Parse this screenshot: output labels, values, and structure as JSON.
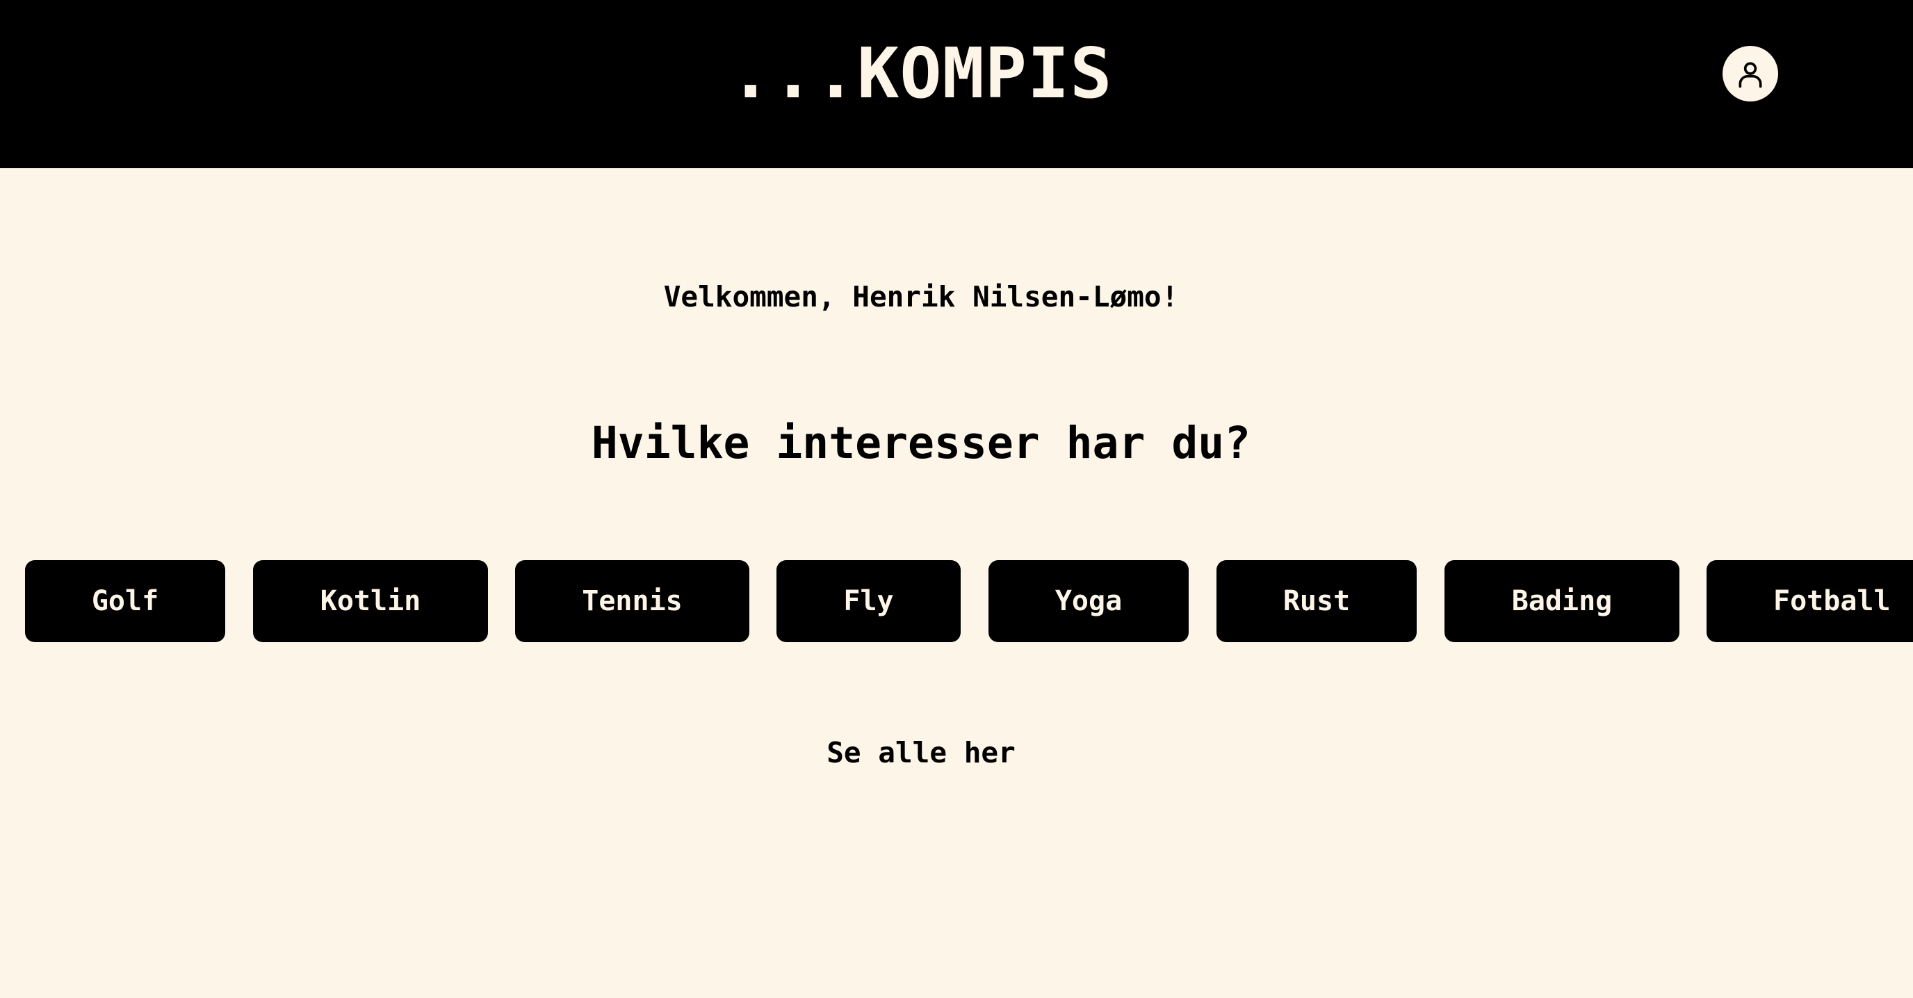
{
  "header": {
    "logo": "...KOMPIS",
    "profile_icon": "user-icon"
  },
  "main": {
    "welcome": "Velkommen, Henrik Nilsen-Lømo!",
    "question": "Hvilke interesser har du?",
    "interests": [
      "Golf",
      "Kotlin",
      "Tennis",
      "Fly",
      "Yoga",
      "Rust",
      "Bading",
      "Fotball"
    ],
    "see_all": "Se alle her"
  },
  "colors": {
    "header_bg": "#000000",
    "page_bg": "#FDF5E8",
    "chip_bg": "#000000",
    "chip_text": "#FDF5E8"
  }
}
